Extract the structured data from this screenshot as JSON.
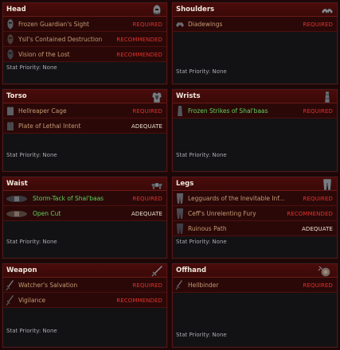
{
  "panels": [
    {
      "title": "Head",
      "slot_icon": "helm-icon",
      "items": [
        {
          "name": "Frozen Guardian's Sight",
          "tag": "REQUIRED",
          "icon": "helm-item-icon"
        },
        {
          "name": "Ysil's Contained Destruction",
          "tag": "RECOMMENDED",
          "icon": "helm-item-icon"
        },
        {
          "name": "Vision of the Lost",
          "tag": "RECOMMENDED",
          "icon": "helm-item-icon"
        }
      ],
      "stat": "Stat Priority: None"
    },
    {
      "title": "Shoulders",
      "slot_icon": "shoulders-icon",
      "items": [
        {
          "name": "Diadewings",
          "tag": "REQUIRED",
          "icon": "shoulder-item-icon"
        }
      ],
      "stat": "Stat Priority: None"
    },
    {
      "title": "Torso",
      "slot_icon": "chest-armor-icon",
      "items": [
        {
          "name": "Hellreaper Cage",
          "tag": "REQUIRED",
          "icon": "armor-item-icon"
        },
        {
          "name": "Plate of Lethal Intent",
          "tag": "ADEQUATE",
          "icon": "armor-item-icon"
        }
      ],
      "stat": "Stat Priority: None"
    },
    {
      "title": "Wrists",
      "slot_icon": "bracer-icon",
      "items": [
        {
          "name": "Frozen Strikes of Shal'baas",
          "tag": "REQUIRED",
          "icon": "bracer-item-icon",
          "set": true
        }
      ],
      "stat": "Stat Priority: None"
    },
    {
      "title": "Waist",
      "slot_icon": "belt-icon",
      "items": [
        {
          "name": "Storm-Tack of Shal'baas",
          "tag": "REQUIRED",
          "icon": "belt-item-icon",
          "set": true
        },
        {
          "name": "Open Cut",
          "tag": "ADEQUATE",
          "icon": "belt-item-icon",
          "set": true
        }
      ],
      "stat": "Stat Priority: None"
    },
    {
      "title": "Legs",
      "slot_icon": "pants-icon",
      "items": [
        {
          "name": "Legguards of the Inevitable Inf...",
          "tag": "REQUIRED",
          "icon": "pants-item-icon"
        },
        {
          "name": "Ceff's Unrelenting Fury",
          "tag": "RECOMMENDED",
          "icon": "pants-item-icon"
        },
        {
          "name": "Ruinous Path",
          "tag": "ADEQUATE",
          "icon": "pants-item-icon"
        }
      ],
      "stat": "Stat Priority: None"
    },
    {
      "title": "Weapon",
      "slot_icon": "sword-icon",
      "items": [
        {
          "name": "Watcher's Salvation",
          "tag": "REQUIRED",
          "icon": "weapon-item-icon"
        },
        {
          "name": "Vigilance",
          "tag": "RECOMMENDED",
          "icon": "weapon-item-icon"
        }
      ],
      "stat": "Stat Priority: None"
    },
    {
      "title": "Offhand",
      "slot_icon": "shield-icon",
      "items": [
        {
          "name": "Hellbinder",
          "tag": "REQUIRED",
          "icon": "offhand-item-icon"
        }
      ],
      "stat": "Stat Priority: None"
    }
  ],
  "colors": {
    "header_bg": "#4a0c0b",
    "row_bg": "#2a0808",
    "item_text": "#c49a72",
    "set_item_text": "#5fd35a",
    "required": "#e0322b",
    "adequate": "#e8dfcf",
    "stat_text": "#a9a9b0"
  }
}
